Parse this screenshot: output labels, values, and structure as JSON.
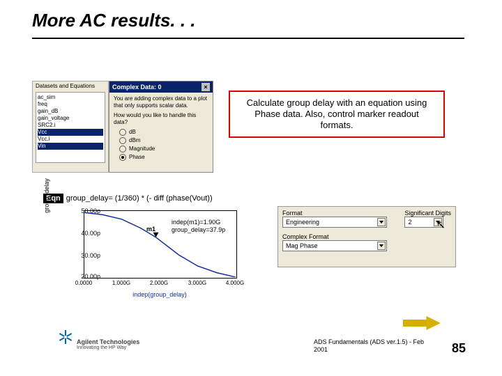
{
  "title": "More AC results. . .",
  "callout": "Calculate group delay with an equation using Phase data.  Also, control marker readout formats.",
  "left_panel": {
    "header": "Datasets and Equations",
    "items": [
      "ac_sim",
      "freq",
      "gain_dB",
      "gain_voltage",
      "SRC2.i",
      "Vcc",
      "Vcc.i",
      "Vin"
    ],
    "selected": [
      "Vcc",
      "Vin"
    ]
  },
  "complex_dialog": {
    "title": "Complex Data: 0",
    "close": "×",
    "msg1": "You are adding complex data to a plot that only supports scalar data.",
    "msg2": "How would you like to handle this data?",
    "options": [
      "dB",
      "dBm",
      "Magnitude",
      "Phase"
    ],
    "selected": "Phase"
  },
  "equation": {
    "tag": "Eqn",
    "text": "group_delay= (1/360) * (- diff (phase(Vout))"
  },
  "chart_data": {
    "type": "line",
    "xlabel": "indep(group_delay)",
    "ylabel": "group_delay",
    "x_ticks": [
      "0.0000",
      "1.000G",
      "2.000G",
      "3.000G",
      "4.000G"
    ],
    "y_ticks": [
      "50.00p",
      "40.00p",
      "30.00p",
      "20.00p"
    ],
    "series": [
      {
        "name": "group_delay",
        "x": [
          0.0,
          0.5,
          1.0,
          1.5,
          1.9,
          2.5,
          3.0,
          3.5,
          4.0
        ],
        "y_ps": [
          49,
          48,
          46,
          42,
          37.9,
          30,
          25,
          22,
          20
        ]
      }
    ],
    "ylim_ps": [
      20,
      50
    ],
    "xlim_g": [
      0,
      4
    ],
    "marker": {
      "name": "m1",
      "lines": [
        "m1",
        "indep(m1)=1.90G",
        "group_delay=37.9p"
      ]
    }
  },
  "format_panel": {
    "format_label": "Format",
    "format_value": "Engineering",
    "sig_label": "Significant Digits",
    "sig_value": "2",
    "complex_label": "Complex Format",
    "complex_value": "Mag Phase"
  },
  "footer": {
    "brand": "Agilent Technologies",
    "sub": "Innovating the HP Way",
    "course": "ADS Fundamentals (ADS ver.1.5) - Feb 2001",
    "page": "85"
  }
}
